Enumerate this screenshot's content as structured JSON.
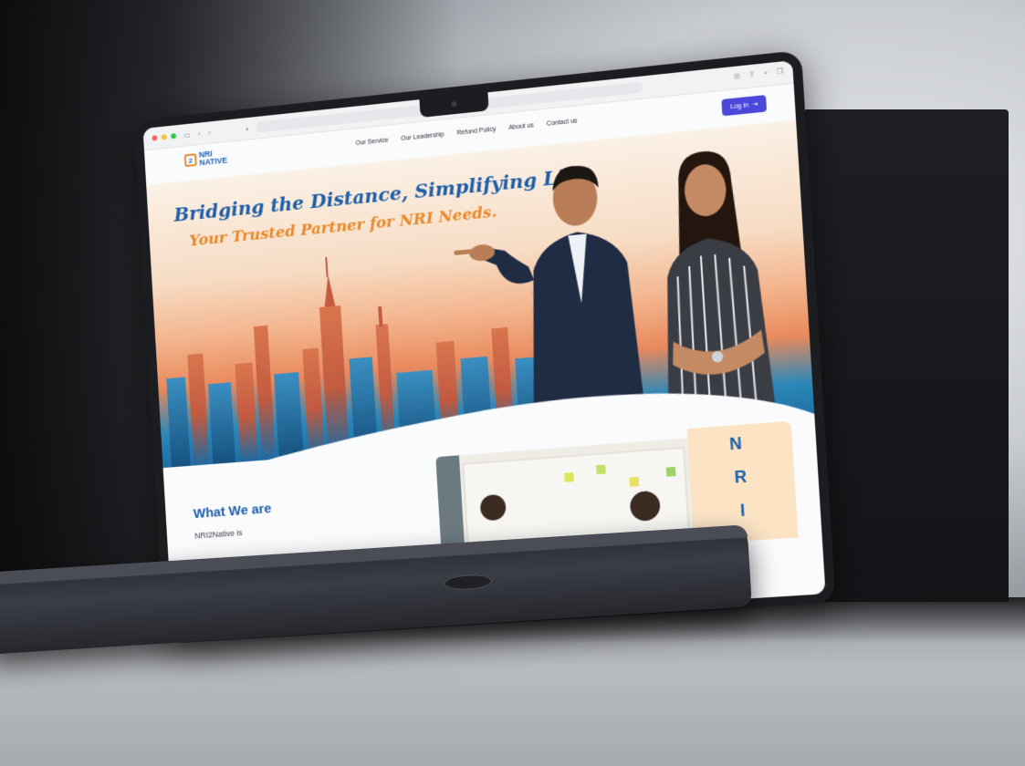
{
  "browser": {
    "icons": [
      "sidebar-icon",
      "back-icon",
      "forward-icon",
      "shield-icon",
      "share-icon",
      "plus-icon",
      "tabs-icon"
    ]
  },
  "site": {
    "logo": {
      "line1": "NRI",
      "line2": "NATIVE"
    },
    "nav": [
      "Our Service",
      "Our Leadership",
      "Refund Policy",
      "About us",
      "Contact us"
    ],
    "login_label": "Log in",
    "hero": {
      "headline": "Bridging the Distance, Simplifying Life",
      "subheadline": "Your Trusted Partner for NRI Needs."
    },
    "about": {
      "title": "What We are",
      "text_start": "NRI2Native is"
    },
    "card_letters": [
      "N",
      "R",
      "I"
    ]
  },
  "colors": {
    "brand_blue": "#1e5fa8",
    "brand_orange": "#e8892a",
    "login_button": "#4a47d9",
    "card_bg": "#fbe3c4"
  }
}
